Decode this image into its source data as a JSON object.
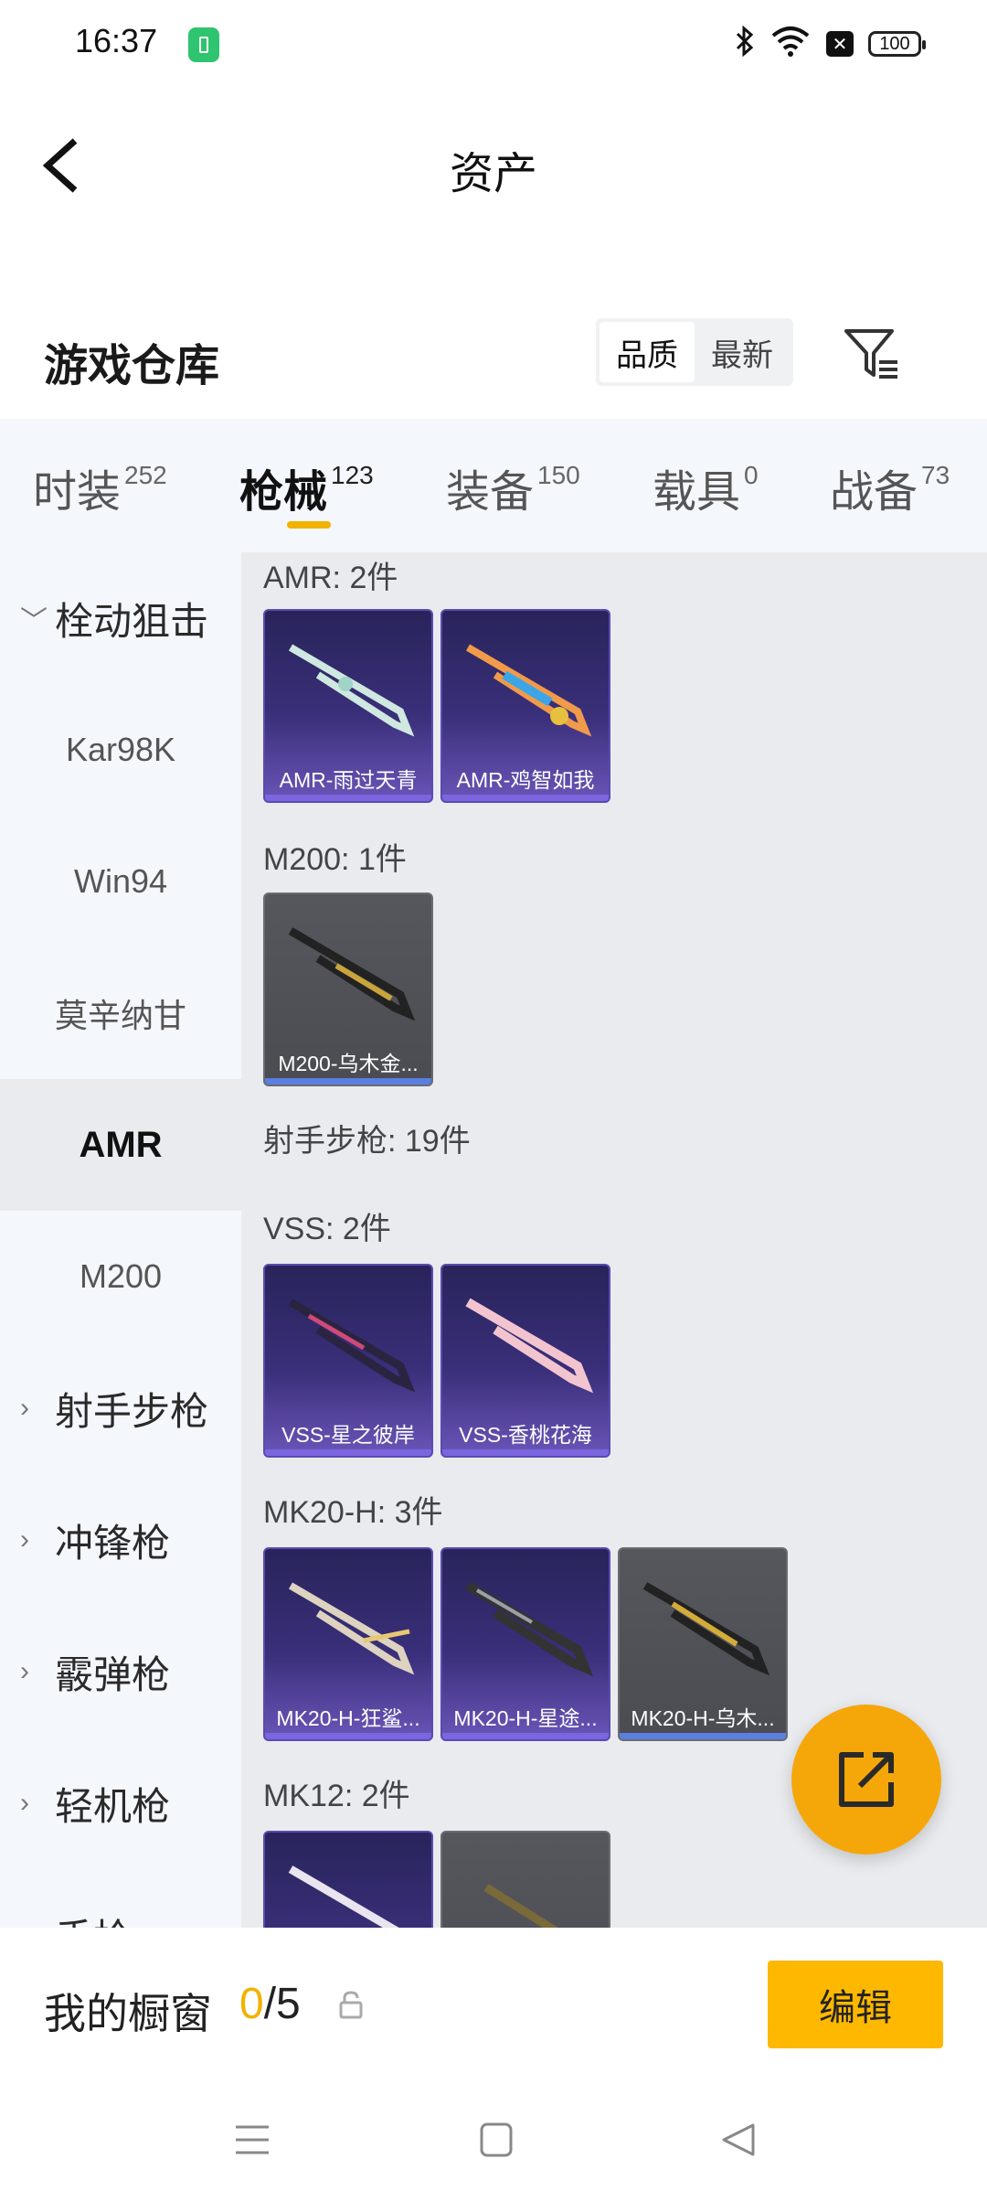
{
  "status_bar": {
    "time": "16:37",
    "battery": "100"
  },
  "header": {
    "title": "资产"
  },
  "warehouse": {
    "title": "游戏仓库",
    "sort_options": [
      "品质",
      "最新"
    ]
  },
  "tabs": [
    {
      "label": "时装",
      "count": "252"
    },
    {
      "label": "枪械",
      "count": "123"
    },
    {
      "label": "装备",
      "count": "150"
    },
    {
      "label": "载具",
      "count": "0"
    },
    {
      "label": "战备",
      "count": "73"
    }
  ],
  "sidebar": {
    "items": [
      {
        "label": "栓动狙击",
        "type": "group",
        "expanded": true
      },
      {
        "label": "Kar98K"
      },
      {
        "label": "Win94"
      },
      {
        "label": "莫辛纳甘"
      },
      {
        "label": "AMR",
        "selected": true
      },
      {
        "label": "M200"
      },
      {
        "label": "射手步枪",
        "type": "group"
      },
      {
        "label": "冲锋枪",
        "type": "group"
      },
      {
        "label": "霰弹枪",
        "type": "group"
      },
      {
        "label": "轻机枪",
        "type": "group"
      },
      {
        "label": "手枪",
        "type": "group"
      }
    ]
  },
  "groups": [
    {
      "title": "AMR: 2件",
      "items": [
        "AMR-雨过天青",
        "AMR-鸡智如我"
      ]
    },
    {
      "title": "M200: 1件",
      "items": [
        "M200-乌木金..."
      ]
    },
    {
      "title": "射手步枪: 19件",
      "items": []
    },
    {
      "title": "VSS: 2件",
      "items": [
        "VSS-星之彼岸",
        "VSS-香桃花海"
      ]
    },
    {
      "title": "MK20-H: 3件",
      "items": [
        "MK20-H-狂鲨...",
        "MK20-H-星途...",
        "MK20-H-乌木..."
      ]
    },
    {
      "title": "MK12: 2件",
      "items": [
        "",
        ""
      ]
    }
  ],
  "showcase": {
    "label": "我的橱窗",
    "current": "0",
    "total": "/5",
    "edit_label": "编辑"
  },
  "colors": {
    "accent": "#f2b200",
    "fab": "#f5a70a",
    "edit_button": "#ffb800"
  }
}
